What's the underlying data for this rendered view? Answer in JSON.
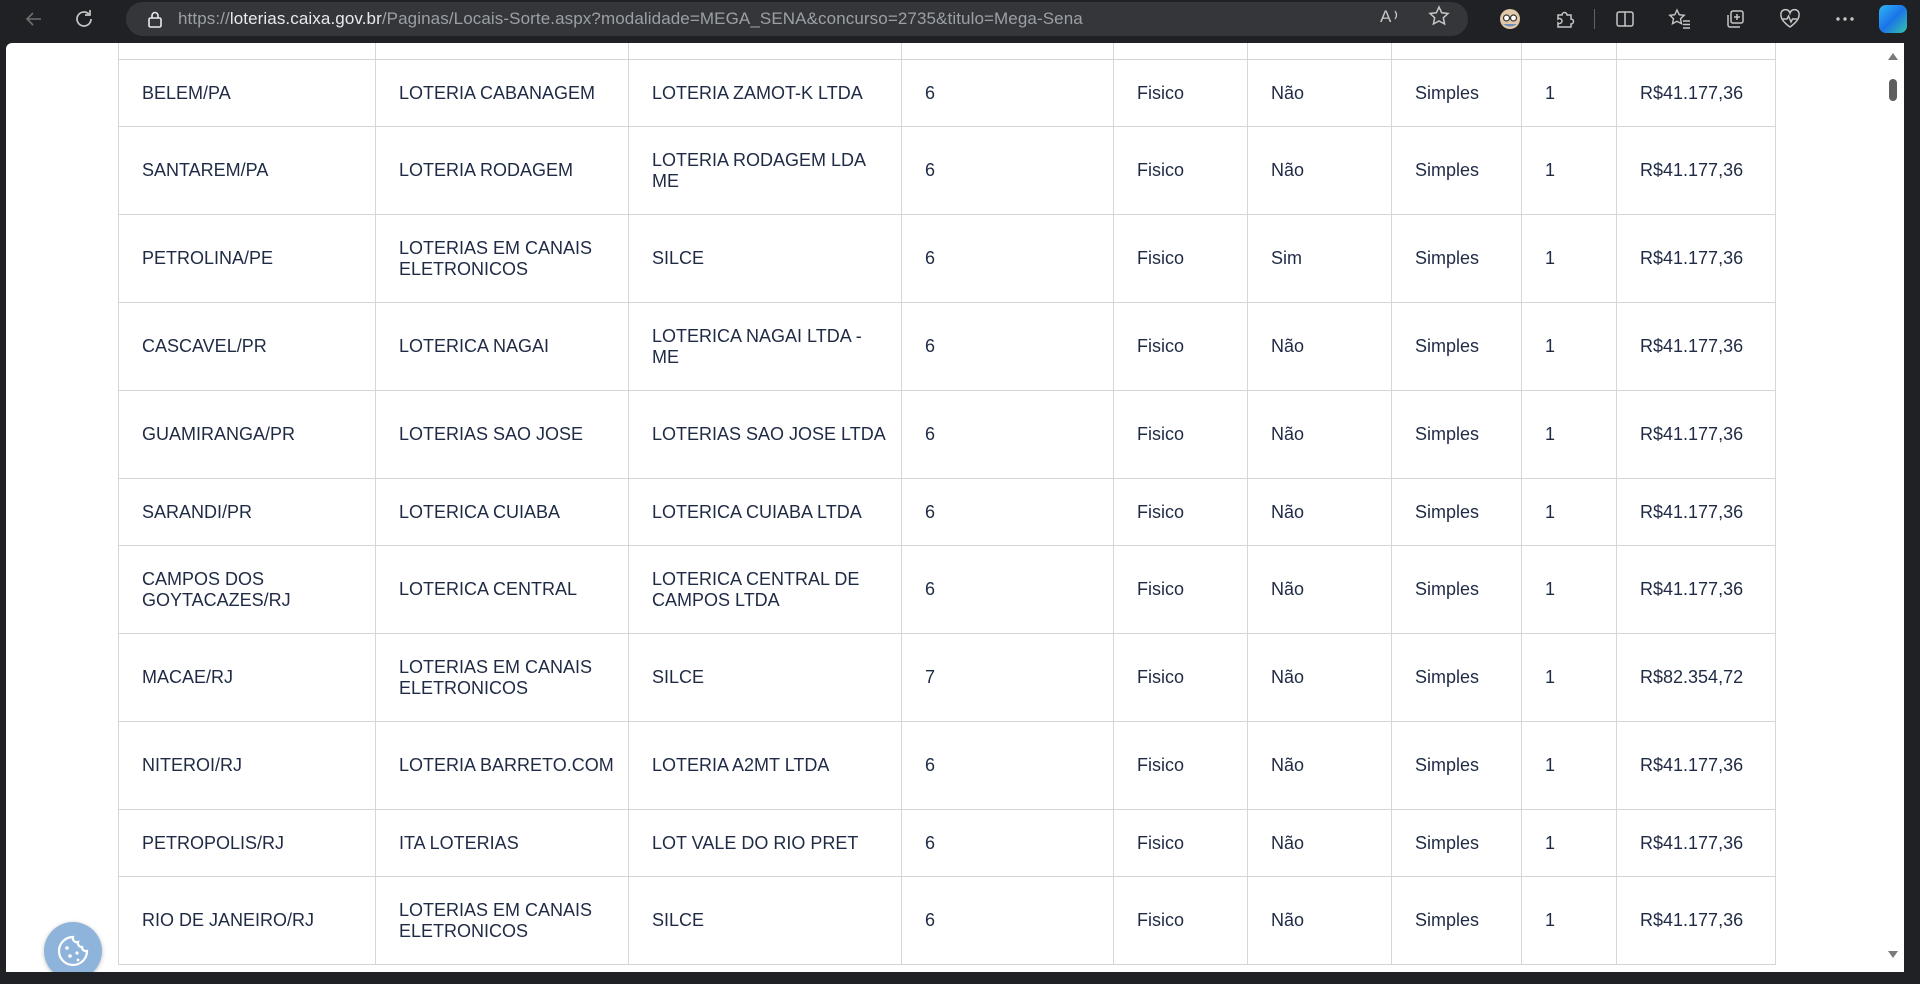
{
  "browser": {
    "url_prefix": "https://",
    "url_host": "loterias.caixa.gov.br",
    "url_path": "/Paginas/Locais-Sorte.aspx?modalidade=MEGA_SENA&concurso=2735&titulo=Mega-Sena",
    "icons": [
      "back-icon",
      "reload-icon",
      "lock-icon",
      "read-aloud-icon",
      "favorite-star-icon",
      "profile-icon",
      "extensions-icon",
      "split-screen-icon",
      "favorites-icon",
      "collections-icon",
      "health-icon",
      "more-icon",
      "copilot-icon"
    ]
  },
  "table": {
    "rows": [
      {
        "city": "",
        "name": "",
        "owner": "",
        "numbers": "",
        "canal": "",
        "teimosinha": "",
        "tipo": "",
        "cotas": "",
        "valor": ""
      },
      {
        "city": "BELEM/PA",
        "name": "LOTERIA CABANAGEM",
        "owner": "LOTERIA ZAMOT-K LTDA",
        "numbers": "6",
        "canal": "Fisico",
        "teimosinha": "Não",
        "tipo": "Simples",
        "cotas": "1",
        "valor": "R$41.177,36"
      },
      {
        "city": "SANTAREM/PA",
        "name": "LOTERIA RODAGEM",
        "owner": "LOTERIA RODAGEM LDA ME",
        "numbers": "6",
        "canal": "Fisico",
        "teimosinha": "Não",
        "tipo": "Simples",
        "cotas": "1",
        "valor": "R$41.177,36"
      },
      {
        "city": "PETROLINA/PE",
        "name": "LOTERIAS EM CANAIS ELETRONICOS",
        "owner": "SILCE",
        "numbers": "6",
        "canal": "Fisico",
        "teimosinha": "Sim",
        "tipo": "Simples",
        "cotas": "1",
        "valor": "R$41.177,36"
      },
      {
        "city": "CASCAVEL/PR",
        "name": "LOTERICA NAGAI",
        "owner": "LOTERICA NAGAI LTDA - ME",
        "numbers": "6",
        "canal": "Fisico",
        "teimosinha": "Não",
        "tipo": "Simples",
        "cotas": "1",
        "valor": "R$41.177,36"
      },
      {
        "city": "GUAMIRANGA/PR",
        "name": "LOTERIAS SAO JOSE",
        "owner": "LOTERIAS SAO JOSE LTDA",
        "numbers": "6",
        "canal": "Fisico",
        "teimosinha": "Não",
        "tipo": "Simples",
        "cotas": "1",
        "valor": "R$41.177,36"
      },
      {
        "city": "SARANDI/PR",
        "name": "LOTERICA CUIABA",
        "owner": "LOTERICA CUIABA LTDA",
        "numbers": "6",
        "canal": "Fisico",
        "teimosinha": "Não",
        "tipo": "Simples",
        "cotas": "1",
        "valor": "R$41.177,36"
      },
      {
        "city": "CAMPOS DOS GOYTACAZES/RJ",
        "name": "LOTERICA CENTRAL",
        "owner": "LOTERICA CENTRAL DE CAMPOS LTDA",
        "numbers": "6",
        "canal": "Fisico",
        "teimosinha": "Não",
        "tipo": "Simples",
        "cotas": "1",
        "valor": "R$41.177,36"
      },
      {
        "city": "MACAE/RJ",
        "name": "LOTERIAS EM CANAIS ELETRONICOS",
        "owner": "SILCE",
        "numbers": "7",
        "canal": "Fisico",
        "teimosinha": "Não",
        "tipo": "Simples",
        "cotas": "1",
        "valor": "R$82.354,72"
      },
      {
        "city": "NITEROI/RJ",
        "name": "LOTERIA BARRETO.COM",
        "owner": "LOTERIA A2MT LTDA",
        "numbers": "6",
        "canal": "Fisico",
        "teimosinha": "Não",
        "tipo": "Simples",
        "cotas": "1",
        "valor": "R$41.177,36"
      },
      {
        "city": "PETROPOLIS/RJ",
        "name": "ITA LOTERIAS",
        "owner": "LOT VALE DO RIO PRET",
        "numbers": "6",
        "canal": "Fisico",
        "teimosinha": "Não",
        "tipo": "Simples",
        "cotas": "1",
        "valor": "R$41.177,36"
      },
      {
        "city": "RIO DE JANEIRO/RJ",
        "name": "LOTERIAS EM CANAIS ELETRONICOS",
        "owner": "SILCE",
        "numbers": "6",
        "canal": "Fisico",
        "teimosinha": "Não",
        "tipo": "Simples",
        "cotas": "1",
        "valor": "R$41.177,36"
      }
    ],
    "row_heights": [
      "stub",
      "single",
      "double",
      "double",
      "double",
      "double",
      "single",
      "double",
      "double",
      "double",
      "single",
      "double"
    ]
  },
  "cookie_button": {
    "icon": "cookie-icon"
  },
  "colors": {
    "chrome_bg": "#202124",
    "address_bg": "#35363a",
    "text": "#1f2a44",
    "border": "#d6d6d6",
    "cookie_bg": "#8fb4dc"
  }
}
